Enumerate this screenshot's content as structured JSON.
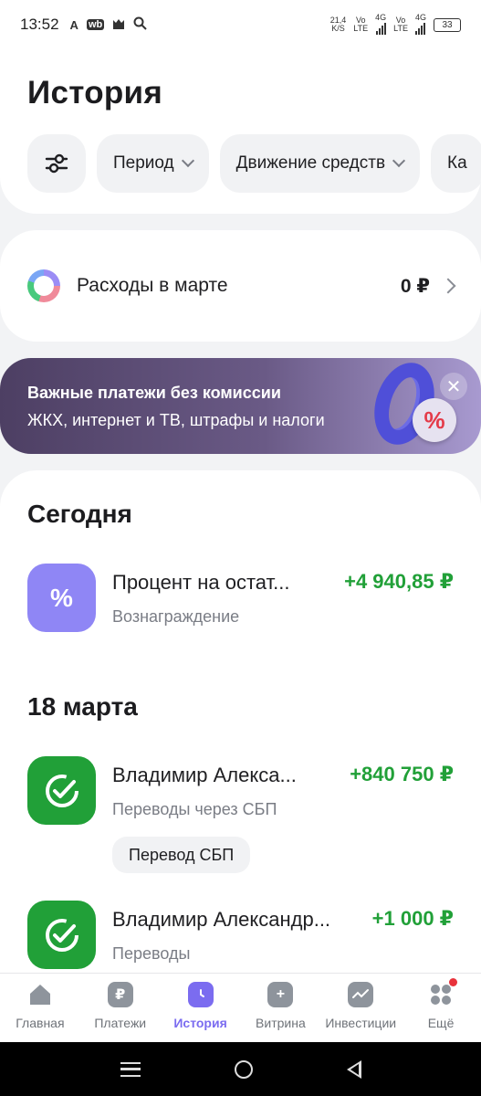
{
  "status_bar": {
    "time": "13:52",
    "left_icons": [
      "A",
      "wb",
      "cat",
      "search"
    ],
    "network_speed_value": "21,4",
    "network_speed_unit": "K/S",
    "sim1_top": "Vo",
    "sim1_bottom": "LTE",
    "sim1_gen": "4G",
    "sim2_top": "Vo",
    "sim2_bottom": "LTE",
    "sim2_gen": "4G",
    "battery": "33"
  },
  "header": {
    "title": "История",
    "filters": [
      {
        "label": "Период"
      },
      {
        "label": "Движение средств"
      },
      {
        "label": "Ка"
      }
    ]
  },
  "expenses": {
    "label": "Расходы в марте",
    "amount": "0 ₽"
  },
  "promo": {
    "title": "Важные платежи без комиссии",
    "subtitle": "ЖКХ, интернет и ТВ, штрафы и налоги",
    "close": "✕",
    "percent_sign": "%"
  },
  "sections": [
    {
      "title": "Сегодня",
      "transactions": [
        {
          "name": "Процент на остат...",
          "category": "Вознаграждение",
          "amount": "+4 940,85 ₽",
          "icon_symbol": "%"
        }
      ]
    },
    {
      "title": "18 марта",
      "transactions": [
        {
          "name": "Владимир Алекса...",
          "category": "Переводы через СБП",
          "amount": "+840 750 ₽",
          "tag": "Перевод СБП"
        },
        {
          "name": "Владимир Александр...",
          "category": "Переводы",
          "amount": "+1 000 ₽"
        }
      ]
    }
  ],
  "nav": {
    "items": [
      {
        "label": "Главная"
      },
      {
        "label": "Платежи",
        "icon_symbol": "₽"
      },
      {
        "label": "История"
      },
      {
        "label": "Витрина",
        "icon_symbol": "+"
      },
      {
        "label": "Инвестиции"
      },
      {
        "label": "Ещё"
      }
    ],
    "active": "История"
  },
  "colors": {
    "accent_purple": "#7b6cf0",
    "income_green": "#21a038",
    "sber_green": "#21a038",
    "percent_icon_bg": "#8f86f5"
  }
}
